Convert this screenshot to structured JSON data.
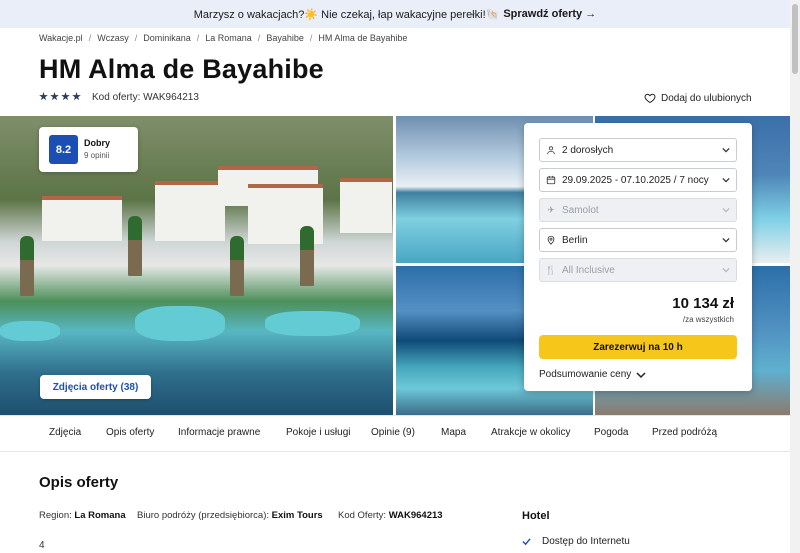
{
  "promo": {
    "text": "Marzysz o wakacjach?☀️ Nie czekaj, łap wakacyjne perełki!🐚",
    "cta": "Sprawdź oferty →"
  },
  "breadcrumb": [
    "Wakacje.pl",
    "Wczasy",
    "Dominikana",
    "La Romana",
    "Bayahibe",
    "HM Alma de Bayahibe"
  ],
  "hotel": {
    "name": "HM Alma de Bayahibe",
    "stars": 4,
    "offer_code_label": "Kod oferty: WAK964213",
    "favorite_label": "Dodaj do ulubionych"
  },
  "rating": {
    "score": "8.2",
    "label": "Dobry",
    "count": "9 opinii"
  },
  "photos_button": "Zdjęcia oferty (38)",
  "booking": {
    "travelers": "2 dorosłych",
    "dates": "29.09.2025 - 07.10.2025 / 7 nocy",
    "transport": "Samolot",
    "departure": "Berlin",
    "board": "All Inclusive",
    "price": "10 134 zł",
    "price_note": "/za wszystkich",
    "book_label": "Zarezerwuj na 10 h",
    "summary_label": "Podsumowanie ceny"
  },
  "tabs": [
    "Zdjęcia",
    "Opis oferty",
    "Informacje prawne",
    "Pokoje i usługi",
    "Opinie (9)",
    "Mapa",
    "Atrakcje w okolicy",
    "Pogoda",
    "Przed podróżą"
  ],
  "description": {
    "title": "Opis oferty",
    "region_label": "Region:",
    "region_value": "La Romana",
    "agency_label": "Biuro podróży (przedsiębiorca):",
    "agency_value": "Exim Tours",
    "code_label": "Kod Oferty:",
    "code_value": "WAK964213",
    "number": "4"
  },
  "hotel_section": {
    "title": "Hotel",
    "amenities": [
      "Dostęp do Internetu"
    ]
  },
  "colors": {
    "accent_blue": "#1c4fb4",
    "cta_yellow": "#f7c61b",
    "promo_bg": "#e9eef9"
  }
}
